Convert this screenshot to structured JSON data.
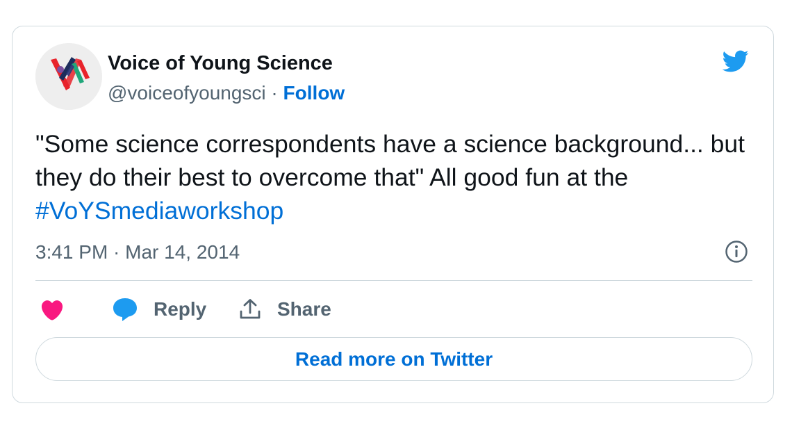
{
  "author": {
    "display_name": "Voice of Young Science",
    "handle": "@voiceofyoungsci",
    "separator": " · ",
    "follow_label": "Follow",
    "avatar_icon": "voys-logo-icon"
  },
  "tweet": {
    "text_before_hashtag": "\"Some science correspondents have a science background... but they do their best to overcome that\" All good fun at the ",
    "hashtag": "#VoYSmediaworkshop",
    "timestamp": "3:41 PM · Mar 14, 2014"
  },
  "actions": {
    "like_icon": "heart-icon",
    "reply_icon": "speech-bubble-icon",
    "reply_label": "Reply",
    "share_icon": "upload-arrow-icon",
    "share_label": "Share"
  },
  "read_more_label": "Read more on Twitter",
  "colors": {
    "link": "#006fd6",
    "twitter_blue": "#1d9bf0",
    "like_pink": "#f91880",
    "muted_text": "#536471",
    "border": "#cfd9de"
  }
}
